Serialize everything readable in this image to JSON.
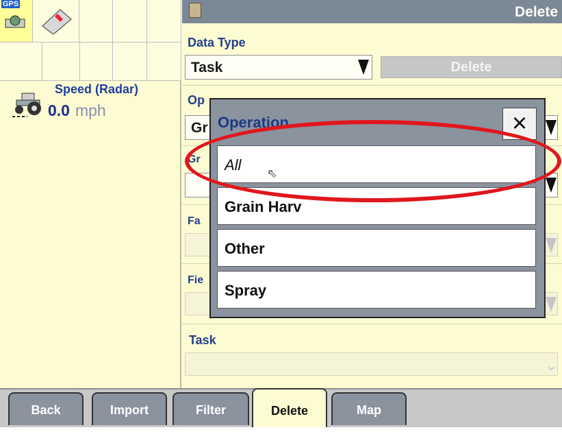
{
  "left": {
    "gps_label": "GPS",
    "speed": {
      "label": "Speed (Radar)",
      "value": "0.0",
      "unit": "mph"
    }
  },
  "header": {
    "title": "Delete"
  },
  "form": {
    "data_type": {
      "label": "Data Type",
      "value": "Task"
    },
    "delete_button": "Delete",
    "operation": {
      "label_partial": "Op",
      "value_partial": "Gr"
    },
    "grower_label_partial": "Gr",
    "farm_label_partial": "Fa",
    "field_label_partial": "Fie",
    "task": {
      "label": "Task",
      "value": ""
    }
  },
  "modal": {
    "title": "Operation",
    "close_label": "×",
    "options": [
      "All",
      "Grain Harv",
      "Other",
      "Spray"
    ]
  },
  "tabs": [
    "Back",
    "Import",
    "Filter",
    "Delete",
    "Map"
  ],
  "active_tab": "Delete",
  "colors": {
    "highlight": "#e0171d",
    "titlebar": "#7b8896",
    "panel": "#fdfbd2"
  }
}
